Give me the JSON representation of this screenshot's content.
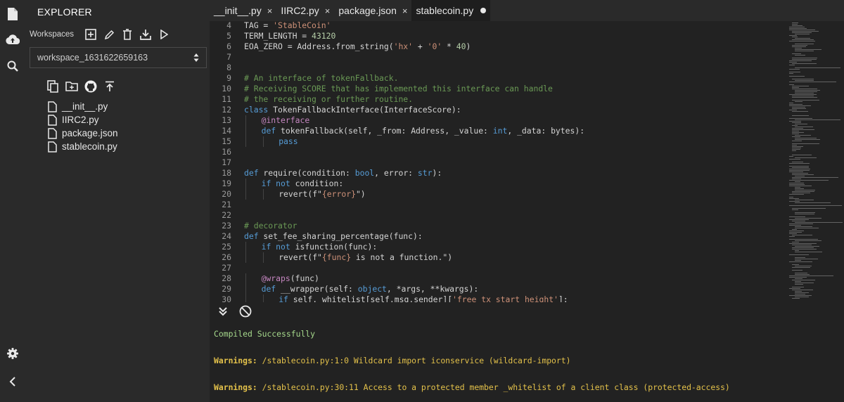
{
  "activity_bar": {
    "icons": [
      "file-icon",
      "deploy-cloud-icon",
      "search-icon",
      "settings-gear-icon",
      "collapse-chevron-icon"
    ]
  },
  "explorer": {
    "title": "EXPLORER",
    "workspaces_label": "Workspaces",
    "workspace_selected": "workspace_1631622659163",
    "files": [
      "__init__.py",
      "IIRC2.py",
      "package.json",
      "stablecoin.py"
    ]
  },
  "tabs": [
    {
      "label": "__init__.py",
      "close": "×",
      "active": false
    },
    {
      "label": "IIRC2.py",
      "close": "×",
      "active": false
    },
    {
      "label": "package.json",
      "close": "×",
      "active": false
    },
    {
      "label": "stablecoin.py",
      "close": "",
      "active": true,
      "modified": true
    }
  ],
  "editor": {
    "lines": [
      {
        "n": "4",
        "indent": 0,
        "tokens": [
          [
            "TAG = ",
            "p"
          ],
          [
            "'StableCoin'",
            "s"
          ]
        ]
      },
      {
        "n": "5",
        "indent": 0,
        "tokens": [
          [
            "TERM_LENGTH = ",
            "p"
          ],
          [
            "43120",
            "num"
          ]
        ]
      },
      {
        "n": "6",
        "indent": 0,
        "tokens": [
          [
            "EOA_ZERO = Address.from_string(",
            "p"
          ],
          [
            "'hx'",
            "s"
          ],
          [
            " + ",
            "p"
          ],
          [
            "'0'",
            "s"
          ],
          [
            " * ",
            "p"
          ],
          [
            "40",
            "num"
          ],
          [
            ")",
            "p"
          ]
        ]
      },
      {
        "n": "7",
        "indent": 0,
        "tokens": []
      },
      {
        "n": "8",
        "indent": 0,
        "tokens": []
      },
      {
        "n": "9",
        "indent": 0,
        "tokens": [
          [
            "# An interface of tokenFallback.",
            "c"
          ]
        ]
      },
      {
        "n": "10",
        "indent": 0,
        "tokens": [
          [
            "# Receiving SCORE that has implemented this interface can handle",
            "c"
          ]
        ]
      },
      {
        "n": "11",
        "indent": 0,
        "tokens": [
          [
            "# the receiving or further routine.",
            "c"
          ]
        ]
      },
      {
        "n": "12",
        "indent": 0,
        "tokens": [
          [
            "class",
            "k"
          ],
          [
            " TokenFallbackInterface(InterfaceScore):",
            "p"
          ]
        ]
      },
      {
        "n": "13",
        "indent": 1,
        "tokens": [
          [
            "@interface",
            "d"
          ]
        ]
      },
      {
        "n": "14",
        "indent": 1,
        "tokens": [
          [
            "def",
            "k"
          ],
          [
            " tokenFallback(self, _from: Address, _value: ",
            "p"
          ],
          [
            "int",
            "k"
          ],
          [
            ", _data: bytes):",
            "p"
          ]
        ]
      },
      {
        "n": "15",
        "indent": 2,
        "tokens": [
          [
            "pass",
            "k"
          ]
        ]
      },
      {
        "n": "16",
        "indent": 0,
        "tokens": []
      },
      {
        "n": "17",
        "indent": 0,
        "tokens": []
      },
      {
        "n": "18",
        "indent": 0,
        "tokens": [
          [
            "def",
            "k"
          ],
          [
            " require(condition: ",
            "p"
          ],
          [
            "bool",
            "k"
          ],
          [
            ", error: ",
            "p"
          ],
          [
            "str",
            "k"
          ],
          [
            "):",
            "p"
          ]
        ]
      },
      {
        "n": "19",
        "indent": 1,
        "tokens": [
          [
            "if",
            "k"
          ],
          [
            " ",
            "p"
          ],
          [
            "not",
            "k"
          ],
          [
            " condition:",
            "p"
          ]
        ]
      },
      {
        "n": "20",
        "indent": 2,
        "tokens": [
          [
            "revert(f\"",
            "p"
          ],
          [
            "{error}",
            "s"
          ],
          [
            "\")",
            "p"
          ]
        ]
      },
      {
        "n": "21",
        "indent": 0,
        "tokens": []
      },
      {
        "n": "22",
        "indent": 0,
        "tokens": []
      },
      {
        "n": "23",
        "indent": 0,
        "tokens": [
          [
            "# decorator",
            "c"
          ]
        ]
      },
      {
        "n": "24",
        "indent": 0,
        "tokens": [
          [
            "def",
            "k"
          ],
          [
            " set_fee_sharing_percentage(func):",
            "p"
          ]
        ]
      },
      {
        "n": "25",
        "indent": 1,
        "tokens": [
          [
            "if",
            "k"
          ],
          [
            " ",
            "p"
          ],
          [
            "not",
            "k"
          ],
          [
            " isfunction(func):",
            "p"
          ]
        ]
      },
      {
        "n": "26",
        "indent": 2,
        "tokens": [
          [
            "revert(f\"",
            "p"
          ],
          [
            "{func}",
            "s"
          ],
          [
            " is not a function.\")",
            "p"
          ]
        ]
      },
      {
        "n": "27",
        "indent": 0,
        "tokens": []
      },
      {
        "n": "28",
        "indent": 1,
        "tokens": [
          [
            "@wraps",
            "d"
          ],
          [
            "(func)",
            "p"
          ]
        ]
      },
      {
        "n": "29",
        "indent": 1,
        "tokens": [
          [
            "def",
            "k"
          ],
          [
            " __wrapper(self: ",
            "p"
          ],
          [
            "object",
            "k"
          ],
          [
            ", *args, **kwargs):",
            "p"
          ]
        ]
      },
      {
        "n": "30",
        "indent": 2,
        "tokens": [
          [
            "if",
            "k"
          ],
          [
            " self._whitelist[self.msg.sender][",
            "p"
          ],
          [
            "'free_tx_start_height'",
            "s"
          ],
          [
            "]:",
            "p"
          ]
        ]
      }
    ]
  },
  "terminal": {
    "compiled": "Compiled Successfully",
    "warnings": [
      {
        "label": "Warnings:",
        "text": " /stablecoin.py:1:0 Wildcard import iconservice (wildcard-import)"
      },
      {
        "label": "Warnings:",
        "text": " /stablecoin.py:30:11 Access to a protected member _whitelist of a client class (protected-access)"
      }
    ]
  },
  "colors": {
    "keyword": "#569cd6",
    "string": "#ce9178",
    "comment": "#6a9955",
    "decorator": "#c586c0",
    "number": "#b5cea8",
    "plain": "#d4d4d4",
    "success": "#a6d98c",
    "warning": "#e3c14a"
  }
}
